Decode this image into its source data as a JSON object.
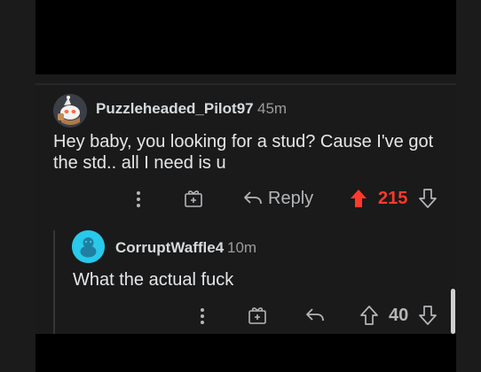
{
  "comments": [
    {
      "username": "Puzzleheaded_Pilot97",
      "time": "45m",
      "body_line1": "Hey baby, you looking for a stud? Cause I've got",
      "body_line2": "the std.. all I need is u",
      "reply_label": "Reply",
      "votes": "215",
      "upvoted": true
    },
    {
      "username": "CorruptWaffle4",
      "time": "10m",
      "body_line1": "What the actual fuck",
      "votes": "40",
      "upvoted": false
    }
  ],
  "colors": {
    "upvote": "#ff3a2b",
    "muted": "#9a9c9e",
    "text": "#e4e6e8",
    "avatar2": "#28c9ea"
  },
  "icons": [
    "more-options-icon",
    "award-icon",
    "reply-arrow-icon",
    "upvote-arrow-icon",
    "downvote-arrow-icon"
  ]
}
